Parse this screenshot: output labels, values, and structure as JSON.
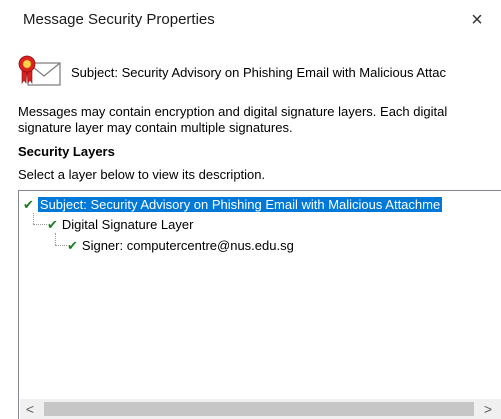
{
  "window": {
    "title": "Message Security Properties",
    "close_symbol": "×"
  },
  "subject_row": {
    "icon": "certificate-envelope-icon",
    "text": "Subject:  Security Advisory on Phishing Email with Malicious Attac"
  },
  "description": "Messages may contain encryption and digital signature layers. Each digital signature layer may contain multiple signatures.",
  "security_layers": {
    "heading": "Security Layers",
    "instruction": "Select a layer below to view its description.",
    "tree": [
      {
        "label": "Subject: Security Advisory on Phishing Email with Malicious Attachme",
        "selected": true,
        "status_icon": "check-icon"
      },
      {
        "label": "Digital Signature Layer",
        "selected": false,
        "status_icon": "check-icon"
      },
      {
        "label": "Signer: computercentre@nus.edu.sg",
        "selected": false,
        "status_icon": "check-icon"
      }
    ],
    "scrollbar": {
      "left_arrow": "<",
      "right_arrow": ">"
    }
  },
  "colors": {
    "selection": "#0078d7",
    "check": "#1e7a1e",
    "ribbon_red": "#d81e1e"
  }
}
